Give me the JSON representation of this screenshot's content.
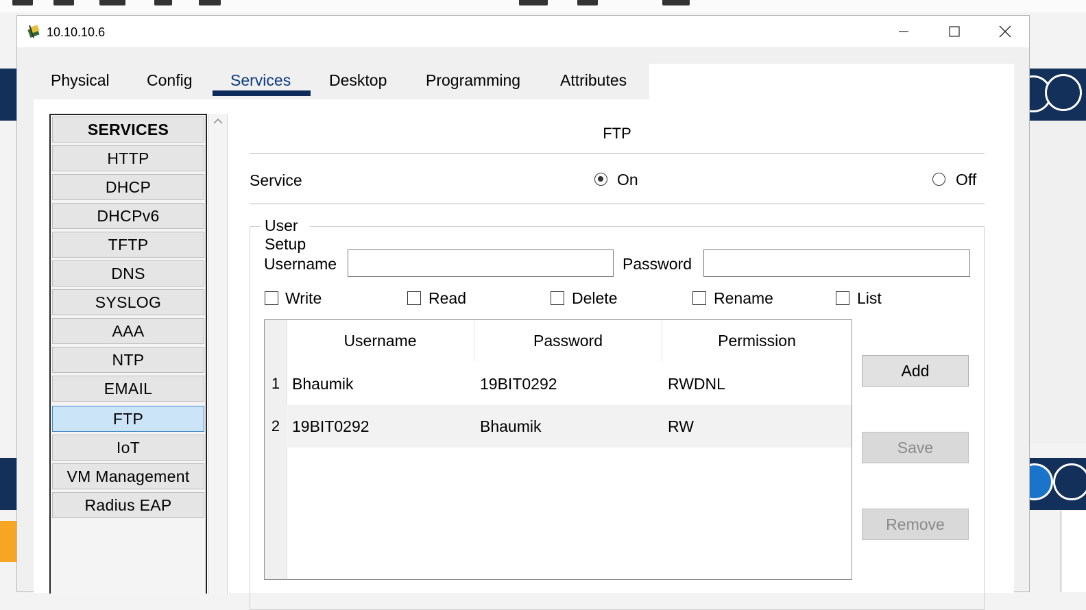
{
  "window": {
    "title": "10.10.10.6"
  },
  "tabs": [
    {
      "label": "Physical"
    },
    {
      "label": "Config"
    },
    {
      "label": "Services"
    },
    {
      "label": "Desktop"
    },
    {
      "label": "Programming"
    },
    {
      "label": "Attributes"
    }
  ],
  "active_tab": "Services",
  "sidebar": {
    "header": "SERVICES",
    "items": [
      {
        "label": "HTTP"
      },
      {
        "label": "DHCP"
      },
      {
        "label": "DHCPv6"
      },
      {
        "label": "TFTP"
      },
      {
        "label": "DNS"
      },
      {
        "label": "SYSLOG"
      },
      {
        "label": "AAA"
      },
      {
        "label": "NTP"
      },
      {
        "label": "EMAIL"
      },
      {
        "label": "FTP"
      },
      {
        "label": "IoT"
      },
      {
        "label": "VM Management"
      },
      {
        "label": "Radius EAP"
      }
    ],
    "selected": "FTP"
  },
  "ftp": {
    "title": "FTP",
    "service_label": "Service",
    "on_label": "On",
    "off_label": "Off",
    "service_state": "On",
    "user_setup": {
      "legend": "User Setup",
      "username_label": "Username",
      "username_value": "",
      "password_label": "Password",
      "password_value": "",
      "permissions": [
        {
          "label": "Write",
          "checked": false
        },
        {
          "label": "Read",
          "checked": false
        },
        {
          "label": "Delete",
          "checked": false
        },
        {
          "label": "Rename",
          "checked": false
        },
        {
          "label": "List",
          "checked": false
        }
      ]
    },
    "table": {
      "columns": [
        "Username",
        "Password",
        "Permission"
      ],
      "rows": [
        {
          "num": "1",
          "username": "Bhaumik",
          "password": "19BIT0292",
          "permission": "RWDNL"
        },
        {
          "num": "2",
          "username": "19BIT0292",
          "password": "Bhaumik",
          "permission": "RW"
        }
      ]
    },
    "buttons": {
      "add": "Add",
      "save": "Save",
      "remove": "Remove"
    }
  },
  "colors": {
    "active_tab_underline": "#0d2a5a",
    "selected_item_bg": "#cce4f7",
    "selected_item_border": "#3c86d0"
  }
}
